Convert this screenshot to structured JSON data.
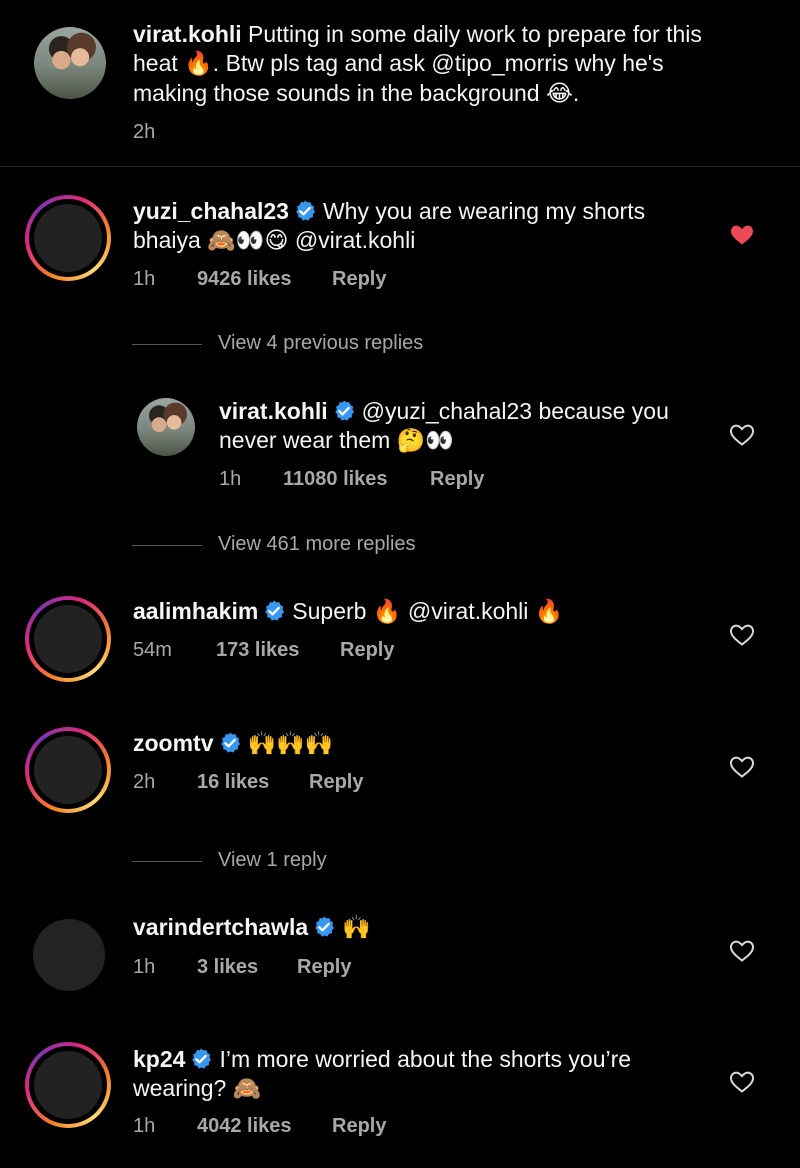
{
  "caption": {
    "username": "virat.kohli",
    "line1_text": "Putting in some daily work to prepare for this",
    "line2_a": "heat",
    "line2_emoji": "🔥",
    "line2_b": ". Btw pls tag and ask @tipo_morris why he's",
    "line3_text": "making those sounds in the background",
    "line3_emoji": "😂",
    "line3_end": ".",
    "time": "2h"
  },
  "comments": [
    {
      "username": "yuzi_chahal23",
      "line1": "Why you are wearing my shorts",
      "line2_a": "bhaiya",
      "line2_emoji": "🙈👀😋",
      "line2_b": "@virat.kohli",
      "time": "1h",
      "likes": "9426 likes",
      "reply": "Reply",
      "liked": true
    },
    {
      "username": "virat.kohli",
      "line1": "@yuzi_chahal23 because you",
      "line2_a": "never wear them",
      "line2_emoji": "🤔👀",
      "time": "1h",
      "likes": "11080 likes",
      "reply": "Reply"
    },
    {
      "username": "aalimhakim",
      "text_a": "Superb",
      "emoji_a": "🔥",
      "text_b": "@virat.kohli",
      "emoji_b": "🔥",
      "time": "54m",
      "likes": "173 likes",
      "reply": "Reply"
    },
    {
      "username": "zoomtv",
      "emoji": "🙌🙌🙌",
      "time": "2h",
      "likes": "16 likes",
      "reply": "Reply"
    },
    {
      "username": "varindertchawla",
      "emoji": "🙌",
      "time": "1h",
      "likes": "3 likes",
      "reply": "Reply"
    },
    {
      "username": "kp24",
      "line1": "I’m more worried about the shorts you’re",
      "line2_a": "wearing?",
      "line2_emoji": "🙈",
      "time": "1h",
      "likes": "4042 likes",
      "reply": "Reply"
    }
  ],
  "view_replies": {
    "previous": "View 4 previous replies",
    "more": "View 461 more replies",
    "one": "View 1 reply"
  },
  "colors": {
    "background": "#000000",
    "liked_heart": "#ed4956",
    "verified_badge": "#3897f0",
    "secondary_text": "#a8a8a8"
  }
}
